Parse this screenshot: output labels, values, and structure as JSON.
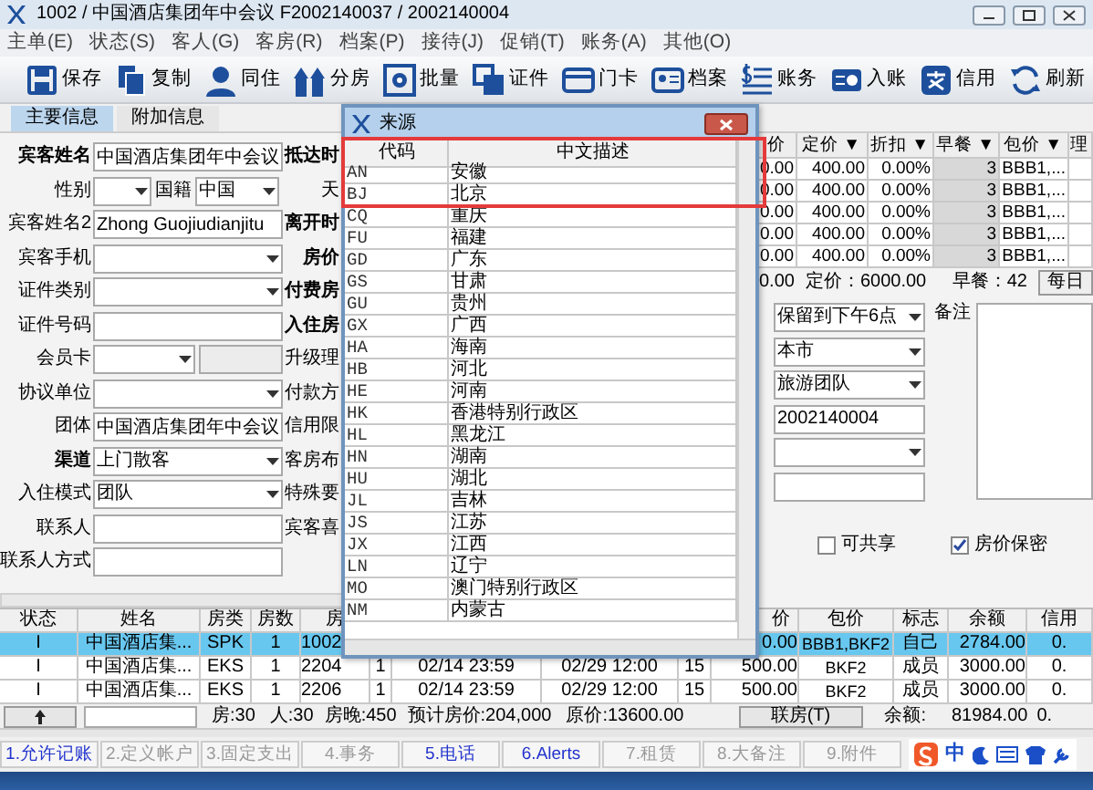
{
  "window": {
    "title": "1002 / 中国酒店集团年中会议  F2002140037 / 2002140004"
  },
  "menu": [
    "主单(E)",
    "状态(S)",
    "客人(G)",
    "客房(R)",
    "档案(P)",
    "接待(J)",
    "促销(T)",
    "账务(A)",
    "其他(O)"
  ],
  "toolbar": [
    "保存",
    "复制",
    "同住",
    "分房",
    "批量",
    "证件",
    "门卡",
    "档案",
    "账务",
    "入账",
    "信用",
    "刷新"
  ],
  "tabs": [
    {
      "label": "主要信息",
      "selected": true
    },
    {
      "label": "附加信息",
      "selected": false
    }
  ],
  "guest_form": [
    {
      "label": "宾客姓名",
      "bold": true,
      "kind": "text",
      "value": "中国酒店集团年中会议"
    },
    {
      "label": "性别",
      "bold": false,
      "kind": "pair",
      "label_2": "国籍",
      "value_2": "中国"
    },
    {
      "label": "宾客姓名2",
      "bold": false,
      "kind": "text",
      "value": "Zhong Guojiudianjitu"
    },
    {
      "label": "宾客手机",
      "bold": false,
      "kind": "select"
    },
    {
      "label": "证件类别",
      "bold": false,
      "kind": "select"
    },
    {
      "label": "证件号码",
      "bold": false,
      "kind": "text"
    },
    {
      "label": "会员卡",
      "bold": false,
      "kind": "card"
    },
    {
      "label": "协议单位",
      "bold": false,
      "kind": "select"
    },
    {
      "label": "团体",
      "bold": false,
      "kind": "text",
      "value": "中国酒店集团年中会议"
    },
    {
      "label": "渠道",
      "bold": true,
      "kind": "select",
      "value": "上门散客"
    },
    {
      "label": "入住模式",
      "bold": false,
      "kind": "select",
      "value": "团队"
    },
    {
      "label": "联系人",
      "bold": false,
      "kind": "text"
    },
    {
      "label": "联系人方式",
      "bold": false,
      "kind": "text"
    }
  ],
  "stay_labels": [
    {
      "label": "抵达时",
      "bold": true
    },
    {
      "label": "天",
      "bold": false
    },
    {
      "label": "离开时",
      "bold": true
    },
    {
      "label": "房价",
      "bold": true
    },
    {
      "label": "付费房",
      "bold": true
    },
    {
      "label": "入住房",
      "bold": true
    },
    {
      "label": "升级理",
      "bold": false
    },
    {
      "label": "付款方",
      "bold": false
    },
    {
      "label": "信用限",
      "bold": false
    },
    {
      "label": "客房布",
      "bold": false
    },
    {
      "label": "特殊要",
      "bold": false
    },
    {
      "label": "宾客喜",
      "bold": false
    }
  ],
  "rate_grid": {
    "columns": [
      "价",
      "定价 ▼",
      "折扣 ▼",
      "早餐 ▼",
      "包价 ▼",
      "理"
    ],
    "rows": [
      [
        "0.00",
        "400.00",
        "0.00%",
        "3",
        "BBB1,..."
      ],
      [
        "0.00",
        "400.00",
        "0.00%",
        "3",
        "BBB1,..."
      ],
      [
        "0.00",
        "400.00",
        "0.00%",
        "3",
        "BBB1,..."
      ],
      [
        "0.00",
        "400.00",
        "0.00%",
        "3",
        "BBB1,..."
      ],
      [
        "0.00",
        "400.00",
        "0.00%",
        "3",
        "BBB1,..."
      ]
    ]
  },
  "rate_summary": {
    "rate": "0.00",
    "list_rate": "定价：6000.00",
    "breakfast": "早餐：42",
    "button": "每日"
  },
  "reservation_form": [
    {
      "kind": "select",
      "value": "保留到下午6点"
    },
    {
      "kind": "select",
      "value": "本市"
    },
    {
      "kind": "select",
      "value": "旅游团队"
    },
    {
      "kind": "text",
      "value": "2002140004"
    },
    {
      "kind": "select"
    },
    {
      "kind": "text"
    }
  ],
  "remarks": {
    "label": "备注"
  },
  "options": [
    {
      "label": "可共享",
      "checked": false
    },
    {
      "label": "房价保密",
      "checked": true
    }
  ],
  "source_dialog": {
    "title": "来源",
    "columns": [
      "代码",
      "中文描述"
    ],
    "rows": [
      {
        "code": "AN",
        "description": "安徽",
        "highlighted": true
      },
      {
        "code": "BJ",
        "description": "北京",
        "highlighted": true
      },
      {
        "code": "CQ",
        "description": "重庆",
        "highlighted": false
      },
      {
        "code": "FU",
        "description": "福建",
        "highlighted": false
      },
      {
        "code": "GD",
        "description": "广东",
        "highlighted": false
      },
      {
        "code": "GS",
        "description": "甘肃",
        "highlighted": false
      },
      {
        "code": "GU",
        "description": "贵州",
        "highlighted": false
      },
      {
        "code": "GX",
        "description": "广西",
        "highlighted": false
      },
      {
        "code": "HA",
        "description": "海南",
        "highlighted": false
      },
      {
        "code": "HB",
        "description": "河北",
        "highlighted": false
      },
      {
        "code": "HE",
        "description": "河南",
        "highlighted": false
      },
      {
        "code": "HK",
        "description": "香港特别行政区",
        "highlighted": false
      },
      {
        "code": "HL",
        "description": "黑龙江",
        "highlighted": false
      },
      {
        "code": "HN",
        "description": "湖南",
        "highlighted": false
      },
      {
        "code": "HU",
        "description": "湖北",
        "highlighted": false
      },
      {
        "code": "JL",
        "description": "吉林",
        "highlighted": false
      },
      {
        "code": "JS",
        "description": "江苏",
        "highlighted": false
      },
      {
        "code": "JX",
        "description": "江西",
        "highlighted": false
      },
      {
        "code": "LN",
        "description": "辽宁",
        "highlighted": false
      },
      {
        "code": "MO",
        "description": "澳门特别行政区",
        "highlighted": false
      },
      {
        "code": "NM",
        "description": "内蒙古",
        "highlighted": false
      }
    ]
  },
  "guest_table": {
    "columns": [
      "状态",
      "姓名",
      "房类",
      "房数",
      "房",
      null,
      null,
      null,
      null,
      "价",
      "包价",
      "标志",
      "余额",
      "信用"
    ],
    "rows": [
      {
        "selected": true,
        "cells": [
          "I",
          "中国酒店集...",
          "SPK",
          "1",
          "1002",
          null,
          null,
          null,
          null,
          "0.00",
          "BBB1,BKF2",
          "自己",
          "2784.00",
          "0."
        ]
      },
      {
        "selected": false,
        "cells": [
          "I",
          "中国酒店集...",
          "EKS",
          "1",
          "2204",
          "1",
          "02/14 23:59",
          "02/29 12:00",
          "15",
          "500.00",
          "BKF2",
          "成员",
          "3000.00",
          "0."
        ]
      },
      {
        "selected": false,
        "cells": [
          "I",
          "中国酒店集...",
          "EKS",
          "1",
          "2206",
          "1",
          "02/14 23:59",
          "02/29 12:00",
          "15",
          "500.00",
          "BKF2",
          "成员",
          "3000.00",
          "0."
        ]
      }
    ]
  },
  "totals": {
    "rooms": "房:30",
    "persons": "人:30",
    "room_nights": "房晚:450",
    "forecast": "预计房价:204,000",
    "original": "原价:13600.00",
    "link_button": "联房(T)",
    "balance_label": "余额:",
    "balance": "81984.00",
    "credit": "0."
  },
  "bottom_tabs": [
    {
      "label": "1.允许记账",
      "enabled": true
    },
    {
      "label": "2.定义帐户",
      "enabled": false
    },
    {
      "label": "3.固定支出",
      "enabled": false
    },
    {
      "label": "4.事务",
      "enabled": false
    },
    {
      "label": "5.电话",
      "enabled": true
    },
    {
      "label": "6.Alerts",
      "enabled": true
    },
    {
      "label": "7.租赁",
      "enabled": false
    },
    {
      "label": "8.大备注",
      "enabled": false
    },
    {
      "label": "9.附件",
      "enabled": false
    }
  ],
  "tray": {
    "ime": "中"
  }
}
